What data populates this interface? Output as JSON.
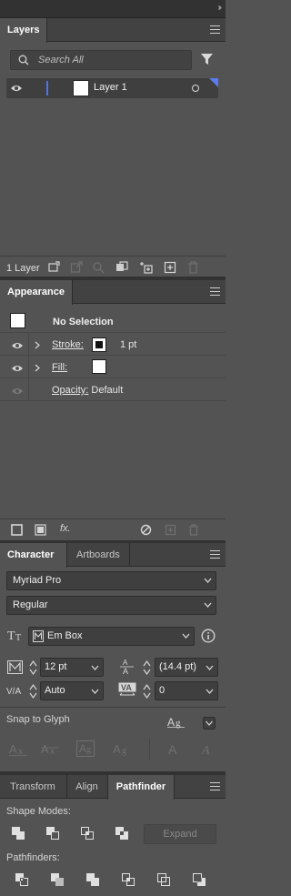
{
  "top": {
    "collapse_glyph": "››"
  },
  "layers_panel": {
    "tab_label": "Layers",
    "search_placeholder": "Search All",
    "layer": {
      "name": "Layer 1",
      "visible": true
    },
    "count_label": "1 Layer"
  },
  "appearance_panel": {
    "tab_label": "Appearance",
    "selection_label": "No Selection",
    "stroke_label": "Stroke:",
    "stroke_weight": "1 pt",
    "fill_label": "Fill:",
    "opacity_label": "Opacity:",
    "opacity_value": "Default",
    "fx_label": "fx."
  },
  "character_panel": {
    "tabs": [
      "Character",
      "Artboards"
    ],
    "font_family": "Myriad Pro",
    "font_style": "Regular",
    "box_mode": "Em Box",
    "font_size": "12 pt",
    "leading": "(14.4 pt)",
    "kerning": "Auto",
    "tracking": "0",
    "snap_to_glyph_label": "Snap to Glyph"
  },
  "pathfinder_panel": {
    "tabs": [
      "Transform",
      "Align",
      "Pathfinder"
    ],
    "active_tab": "Pathfinder",
    "shape_modes_label": "Shape Modes:",
    "expand_label": "Expand",
    "pathfinders_label": "Pathfinders:"
  },
  "colors": {
    "panel_bg": "#535353",
    "tab_bar_bg": "#424242",
    "accent_blue": "#4f73f0"
  }
}
